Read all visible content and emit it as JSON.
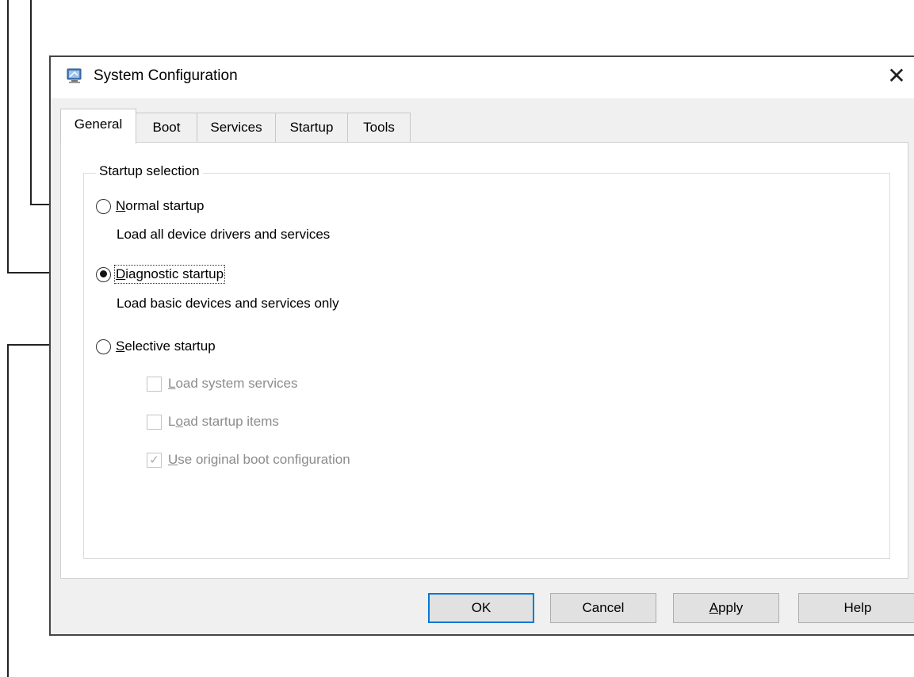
{
  "window": {
    "title": "System Configuration",
    "icon": "system-config-icon",
    "close_label": "✕"
  },
  "tabs": [
    {
      "label": "General",
      "active": true
    },
    {
      "label": "Boot",
      "active": false
    },
    {
      "label": "Services",
      "active": false
    },
    {
      "label": "Startup",
      "active": false
    },
    {
      "label": "Tools",
      "active": false
    }
  ],
  "startup_selection": {
    "legend": "Startup selection",
    "selected": "diagnostic",
    "normal": {
      "key": "N",
      "rest": "ormal startup",
      "description": "Load all device drivers and services"
    },
    "diagnostic": {
      "key": "D",
      "rest": "iagnostic startup",
      "description": "Load basic devices and services only"
    },
    "selective": {
      "key": "S",
      "rest": "elective startup"
    },
    "options": [
      {
        "pre": "",
        "key": "L",
        "rest": "oad system services",
        "checked": false,
        "enabled": false
      },
      {
        "pre": "L",
        "key": "o",
        "rest": "ad startup items",
        "checked": false,
        "enabled": false
      },
      {
        "pre": "",
        "key": "U",
        "rest": "se original boot configuration",
        "checked": true,
        "enabled": false
      }
    ]
  },
  "buttons": {
    "ok": "OK",
    "cancel": "Cancel",
    "apply_key": "A",
    "apply_rest": "pply",
    "help": "Help"
  },
  "colors": {
    "focus_border": "#0078d7",
    "dialog_bg": "#f0f0f0",
    "disabled_text": "#8c8c8c"
  }
}
